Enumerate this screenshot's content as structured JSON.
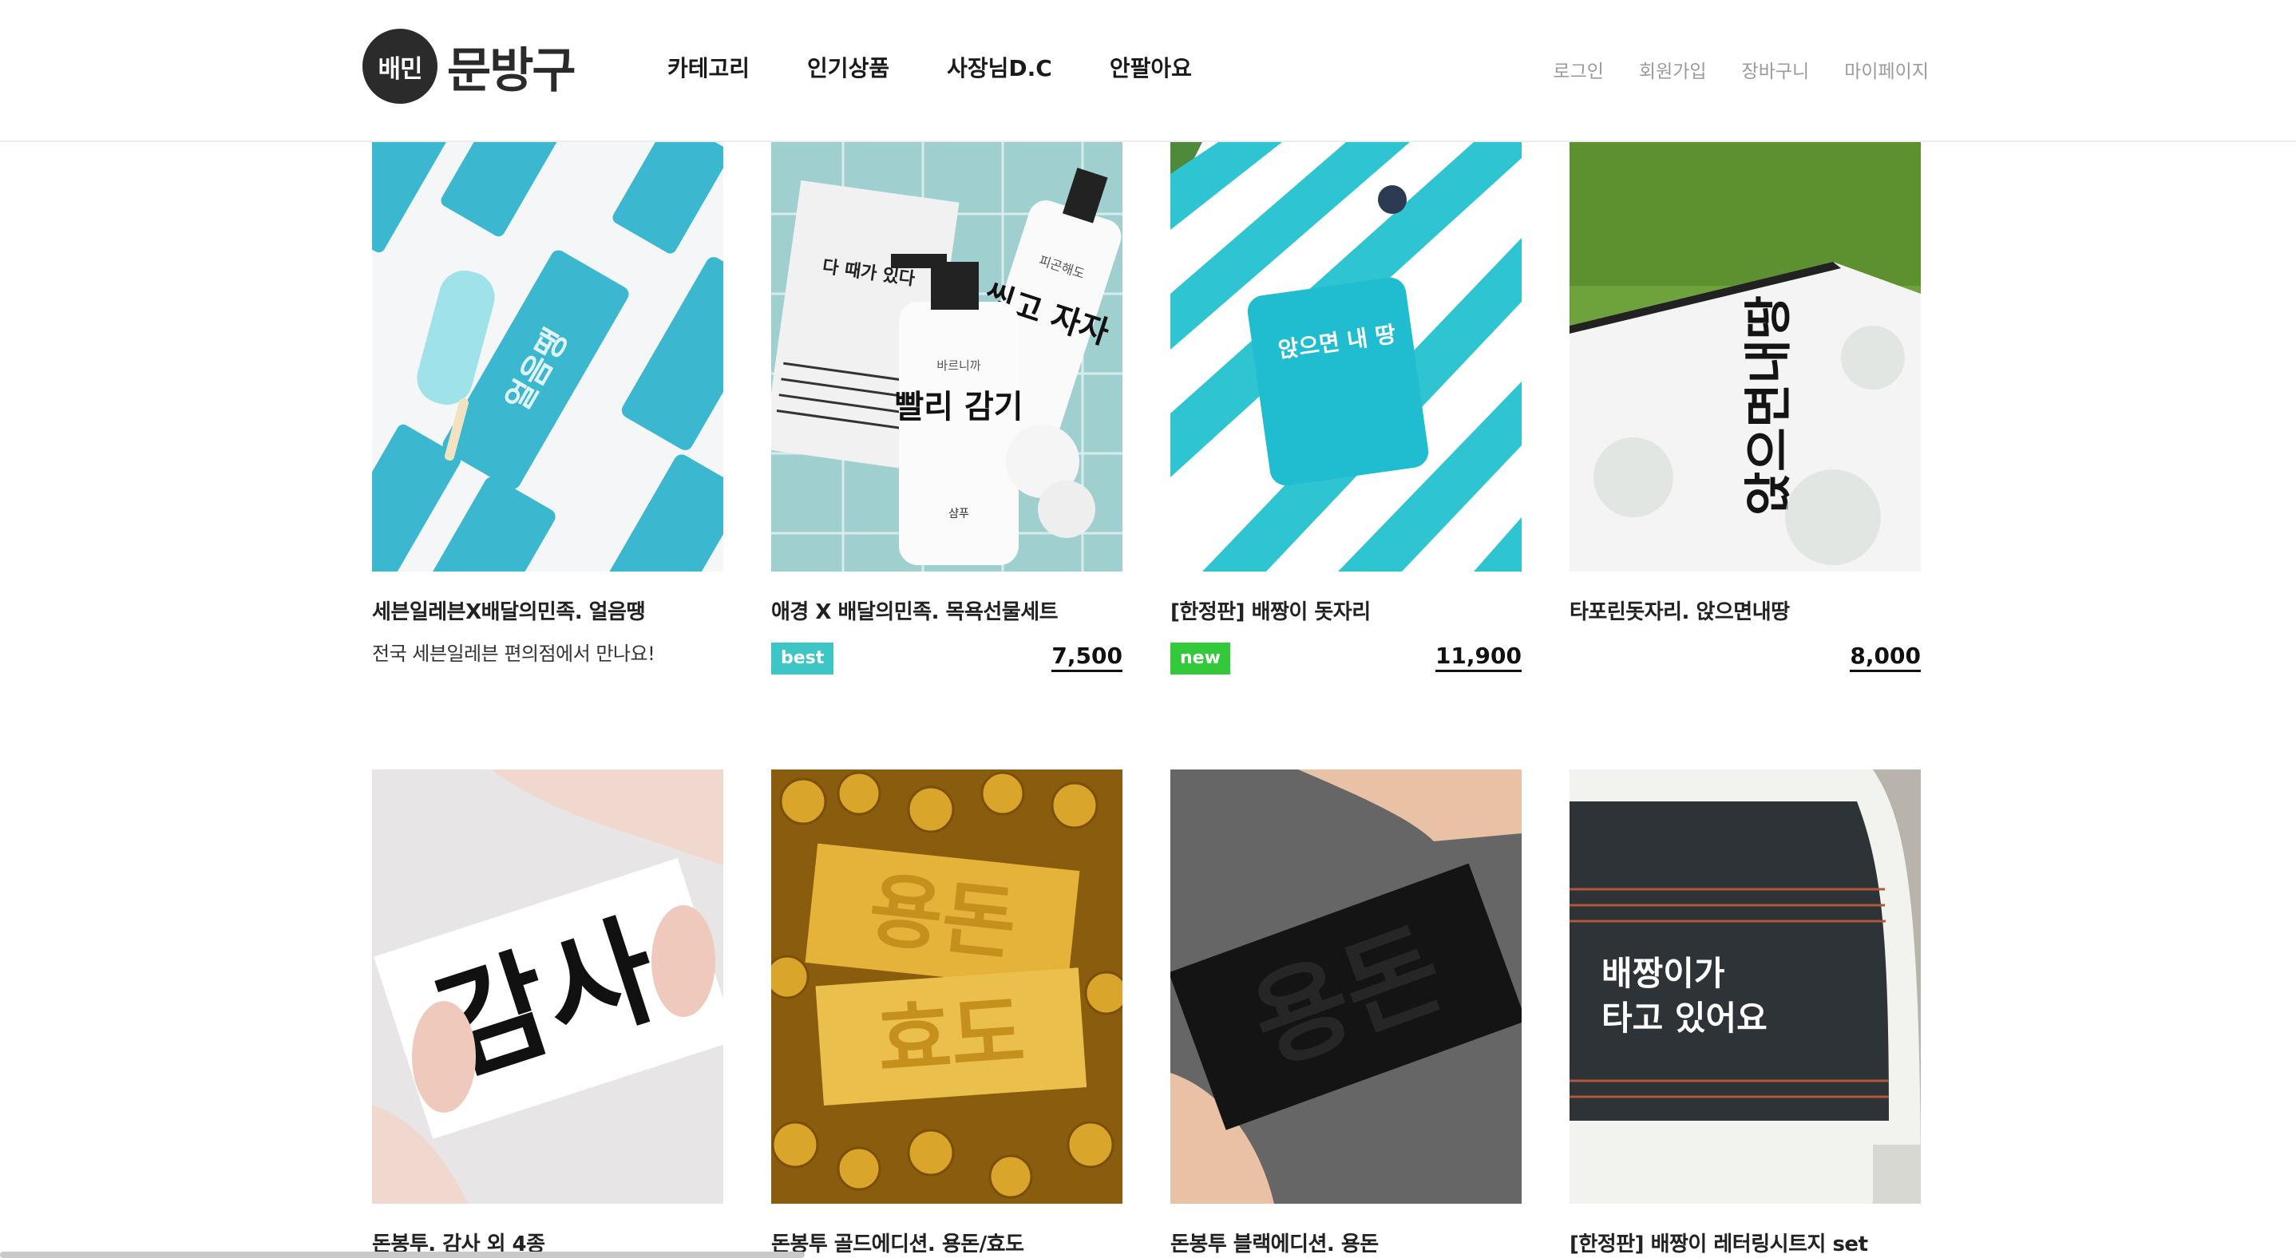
{
  "brand": {
    "badge": "배민",
    "name": "문방구"
  },
  "main_nav": [
    {
      "label": "카테고리"
    },
    {
      "label": "인기상품"
    },
    {
      "label": "사장님D.C"
    },
    {
      "label": "안팔아요"
    }
  ],
  "user_nav": [
    {
      "label": "로그인"
    },
    {
      "label": "회원가입"
    },
    {
      "label": "장바구니"
    },
    {
      "label": "마이페이지"
    }
  ],
  "products": [
    {
      "title": "세븐일레븐X배달의민족. 얼음땡",
      "subtitle": "전국 세븐일레븐 편의점에서 만나요!",
      "badge": "",
      "price": ""
    },
    {
      "title": "애경 X 배달의민족. 목욕선물세트",
      "subtitle": "",
      "badge": "best",
      "price": "7,500"
    },
    {
      "title": "[한정판] 배짱이 돗자리",
      "subtitle": "",
      "badge": "new",
      "price": "11,900"
    },
    {
      "title": "타포린돗자리. 앉으면내땅",
      "subtitle": "",
      "badge": "",
      "price": "8,000"
    },
    {
      "title": "돈봉투. 감사 외 4종",
      "subtitle": "",
      "badge": "",
      "price": ""
    },
    {
      "title": "돈봉투 골드에디션. 용돈/효도",
      "subtitle": "",
      "badge": "",
      "price": ""
    },
    {
      "title": "돈봉투 블랙에디션. 용돈",
      "subtitle": "",
      "badge": "",
      "price": ""
    },
    {
      "title": "[한정판] 배짱이 레터링시트지 set",
      "subtitle": "",
      "badge": "",
      "price": ""
    }
  ],
  "image_text": {
    "popsicle": "얼음땡",
    "towel": "다 때가 있다",
    "shampoo": "빨리 감기",
    "shampoo_top": "바르니까",
    "shampoo_bottom": "샴푸",
    "wash": "씻고 자자",
    "wash_top": "피곤해도",
    "pouch": "앉으면 내 땅",
    "mat": "앉으면내땅",
    "envelope_thanks": "감사",
    "gold_1": "용돈",
    "gold_2": "효도",
    "black": "용돈",
    "car": "배짱이가 타고 있어요"
  }
}
